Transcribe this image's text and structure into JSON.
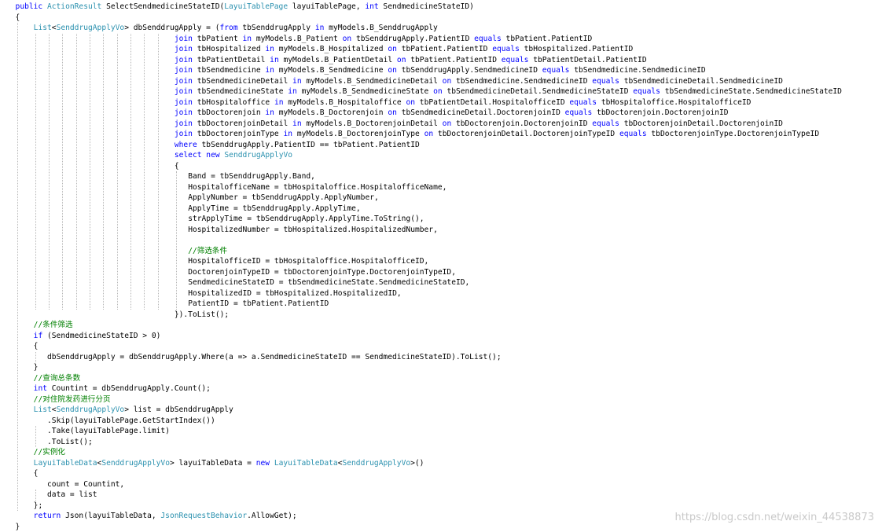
{
  "code": {
    "lines": [
      {
        "indent": 2,
        "tokens": [
          {
            "t": "kw",
            "s": "public "
          },
          {
            "t": "ty",
            "s": "ActionResult"
          },
          {
            "t": "pl",
            "s": " SelectSendmedicineStateID("
          },
          {
            "t": "ty",
            "s": "LayuiTablePage"
          },
          {
            "t": "pl",
            "s": " layuiTablePage, "
          },
          {
            "t": "kw",
            "s": "int"
          },
          {
            "t": "pl",
            "s": " SendmedicineStateID)"
          }
        ]
      },
      {
        "indent": 2,
        "tokens": [
          {
            "t": "pl",
            "s": "{"
          }
        ]
      },
      {
        "indent": 6,
        "tokens": [
          {
            "t": "ty",
            "s": "List"
          },
          {
            "t": "pl",
            "s": "<"
          },
          {
            "t": "ty",
            "s": "SenddrugApplyVo"
          },
          {
            "t": "pl",
            "s": "> dbSenddrugApply = ("
          },
          {
            "t": "kw",
            "s": "from"
          },
          {
            "t": "pl",
            "s": " tbSenddrugApply "
          },
          {
            "t": "kw",
            "s": "in"
          },
          {
            "t": "pl",
            "s": " myModels.B_SenddrugApply"
          }
        ]
      },
      {
        "indent": 37,
        "tokens": [
          {
            "t": "kw",
            "s": "join"
          },
          {
            "t": "pl",
            "s": " tbPatient "
          },
          {
            "t": "kw",
            "s": "in"
          },
          {
            "t": "pl",
            "s": " myModels.B_Patient "
          },
          {
            "t": "kw",
            "s": "on"
          },
          {
            "t": "pl",
            "s": " tbSenddrugApply.PatientID "
          },
          {
            "t": "kw",
            "s": "equals"
          },
          {
            "t": "pl",
            "s": " tbPatient.PatientID"
          }
        ]
      },
      {
        "indent": 37,
        "tokens": [
          {
            "t": "kw",
            "s": "join"
          },
          {
            "t": "pl",
            "s": " tbHospitalized "
          },
          {
            "t": "kw",
            "s": "in"
          },
          {
            "t": "pl",
            "s": " myModels.B_Hospitalized "
          },
          {
            "t": "kw",
            "s": "on"
          },
          {
            "t": "pl",
            "s": " tbPatient.PatientID "
          },
          {
            "t": "kw",
            "s": "equals"
          },
          {
            "t": "pl",
            "s": " tbHospitalized.PatientID"
          }
        ]
      },
      {
        "indent": 37,
        "tokens": [
          {
            "t": "kw",
            "s": "join"
          },
          {
            "t": "pl",
            "s": " tbPatientDetail "
          },
          {
            "t": "kw",
            "s": "in"
          },
          {
            "t": "pl",
            "s": " myModels.B_PatientDetail "
          },
          {
            "t": "kw",
            "s": "on"
          },
          {
            "t": "pl",
            "s": " tbPatient.PatientID "
          },
          {
            "t": "kw",
            "s": "equals"
          },
          {
            "t": "pl",
            "s": " tbPatientDetail.PatientID"
          }
        ]
      },
      {
        "indent": 37,
        "tokens": [
          {
            "t": "kw",
            "s": "join"
          },
          {
            "t": "pl",
            "s": " tbSendmedicine "
          },
          {
            "t": "kw",
            "s": "in"
          },
          {
            "t": "pl",
            "s": " myModels.B_Sendmedicine "
          },
          {
            "t": "kw",
            "s": "on"
          },
          {
            "t": "pl",
            "s": " tbSenddrugApply.SendmedicineID "
          },
          {
            "t": "kw",
            "s": "equals"
          },
          {
            "t": "pl",
            "s": " tbSendmedicine.SendmedicineID"
          }
        ]
      },
      {
        "indent": 37,
        "tokens": [
          {
            "t": "kw",
            "s": "join"
          },
          {
            "t": "pl",
            "s": " tbSendmedicineDetail "
          },
          {
            "t": "kw",
            "s": "in"
          },
          {
            "t": "pl",
            "s": " myModels.B_SendmedicineDetail "
          },
          {
            "t": "kw",
            "s": "on"
          },
          {
            "t": "pl",
            "s": " tbSendmedicine.SendmedicineID "
          },
          {
            "t": "kw",
            "s": "equals"
          },
          {
            "t": "pl",
            "s": " tbSendmedicineDetail.SendmedicineID"
          }
        ]
      },
      {
        "indent": 37,
        "tokens": [
          {
            "t": "kw",
            "s": "join"
          },
          {
            "t": "pl",
            "s": " tbSendmedicineState "
          },
          {
            "t": "kw",
            "s": "in"
          },
          {
            "t": "pl",
            "s": " myModels.B_SendmedicineState "
          },
          {
            "t": "kw",
            "s": "on"
          },
          {
            "t": "pl",
            "s": " tbSendmedicineDetail.SendmedicineStateID "
          },
          {
            "t": "kw",
            "s": "equals"
          },
          {
            "t": "pl",
            "s": " tbSendmedicineState.SendmedicineStateID"
          }
        ]
      },
      {
        "indent": 37,
        "tokens": [
          {
            "t": "kw",
            "s": "join"
          },
          {
            "t": "pl",
            "s": " tbHospitaloffice "
          },
          {
            "t": "kw",
            "s": "in"
          },
          {
            "t": "pl",
            "s": " myModels.B_Hospitaloffice "
          },
          {
            "t": "kw",
            "s": "on"
          },
          {
            "t": "pl",
            "s": " tbPatientDetail.HospitalofficeID "
          },
          {
            "t": "kw",
            "s": "equals"
          },
          {
            "t": "pl",
            "s": " tbHospitaloffice.HospitalofficeID"
          }
        ]
      },
      {
        "indent": 37,
        "tokens": [
          {
            "t": "kw",
            "s": "join"
          },
          {
            "t": "pl",
            "s": " tbDoctorenjoin "
          },
          {
            "t": "kw",
            "s": "in"
          },
          {
            "t": "pl",
            "s": " myModels.B_Doctorenjoin "
          },
          {
            "t": "kw",
            "s": "on"
          },
          {
            "t": "pl",
            "s": " tbSendmedicineDetail.DoctorenjoinID "
          },
          {
            "t": "kw",
            "s": "equals"
          },
          {
            "t": "pl",
            "s": " tbDoctorenjoin.DoctorenjoinID"
          }
        ]
      },
      {
        "indent": 37,
        "tokens": [
          {
            "t": "kw",
            "s": "join"
          },
          {
            "t": "pl",
            "s": " tbDoctorenjoinDetail "
          },
          {
            "t": "kw",
            "s": "in"
          },
          {
            "t": "pl",
            "s": " myModels.B_DoctorenjoinDetail "
          },
          {
            "t": "kw",
            "s": "on"
          },
          {
            "t": "pl",
            "s": " tbDoctorenjoin.DoctorenjoinID "
          },
          {
            "t": "kw",
            "s": "equals"
          },
          {
            "t": "pl",
            "s": " tbDoctorenjoinDetail.DoctorenjoinID"
          }
        ]
      },
      {
        "indent": 37,
        "tokens": [
          {
            "t": "kw",
            "s": "join"
          },
          {
            "t": "pl",
            "s": " tbDoctorenjoinType "
          },
          {
            "t": "kw",
            "s": "in"
          },
          {
            "t": "pl",
            "s": " myModels.B_DoctorenjoinType "
          },
          {
            "t": "kw",
            "s": "on"
          },
          {
            "t": "pl",
            "s": " tbDoctorenjoinDetail.DoctorenjoinTypeID "
          },
          {
            "t": "kw",
            "s": "equals"
          },
          {
            "t": "pl",
            "s": " tbDoctorenjoinType.DoctorenjoinTypeID"
          }
        ]
      },
      {
        "indent": 37,
        "tokens": [
          {
            "t": "kw",
            "s": "where"
          },
          {
            "t": "pl",
            "s": " tbSenddrugApply.PatientID == tbPatient.PatientID"
          }
        ]
      },
      {
        "indent": 37,
        "tokens": [
          {
            "t": "kw",
            "s": "select new "
          },
          {
            "t": "ty",
            "s": "SenddrugApplyVo"
          }
        ]
      },
      {
        "indent": 37,
        "tokens": [
          {
            "t": "pl",
            "s": "{"
          }
        ]
      },
      {
        "indent": 40,
        "tokens": [
          {
            "t": "pl",
            "s": "Band = tbSenddrugApply.Band,"
          }
        ]
      },
      {
        "indent": 40,
        "tokens": [
          {
            "t": "pl",
            "s": "HospitalofficeName = tbHospitaloffice.HospitalofficeName,"
          }
        ]
      },
      {
        "indent": 40,
        "tokens": [
          {
            "t": "pl",
            "s": "ApplyNumber = tbSenddrugApply.ApplyNumber,"
          }
        ]
      },
      {
        "indent": 40,
        "tokens": [
          {
            "t": "pl",
            "s": "ApplyTime = tbSenddrugApply.ApplyTime,"
          }
        ]
      },
      {
        "indent": 40,
        "tokens": [
          {
            "t": "pl",
            "s": "strApplyTime = tbSenddrugApply.ApplyTime.ToString(),"
          }
        ]
      },
      {
        "indent": 40,
        "tokens": [
          {
            "t": "pl",
            "s": "HospitalizedNumber = tbHospitalized.HospitalizedNumber,"
          }
        ]
      },
      {
        "indent": 40,
        "tokens": []
      },
      {
        "indent": 40,
        "tokens": [
          {
            "t": "cm",
            "s": "//筛选条件"
          }
        ]
      },
      {
        "indent": 40,
        "tokens": [
          {
            "t": "pl",
            "s": "HospitalofficeID = tbHospitaloffice.HospitalofficeID,"
          }
        ]
      },
      {
        "indent": 40,
        "tokens": [
          {
            "t": "pl",
            "s": "DoctorenjoinTypeID = tbDoctorenjoinType.DoctorenjoinTypeID,"
          }
        ]
      },
      {
        "indent": 40,
        "tokens": [
          {
            "t": "pl",
            "s": "SendmedicineStateID = tbSendmedicineState.SendmedicineStateID,"
          }
        ]
      },
      {
        "indent": 40,
        "tokens": [
          {
            "t": "pl",
            "s": "HospitalizedID = tbHospitalized.HospitalizedID,"
          }
        ]
      },
      {
        "indent": 40,
        "tokens": [
          {
            "t": "pl",
            "s": "PatientID = tbPatient.PatientID"
          }
        ]
      },
      {
        "indent": 37,
        "tokens": [
          {
            "t": "pl",
            "s": "}).ToList();"
          }
        ]
      },
      {
        "indent": 6,
        "tokens": [
          {
            "t": "cm",
            "s": "//条件筛选"
          }
        ]
      },
      {
        "indent": 6,
        "tokens": [
          {
            "t": "kw",
            "s": "if"
          },
          {
            "t": "pl",
            "s": " (SendmedicineStateID > 0)"
          }
        ]
      },
      {
        "indent": 6,
        "tokens": [
          {
            "t": "pl",
            "s": "{"
          }
        ]
      },
      {
        "indent": 9,
        "tokens": [
          {
            "t": "pl",
            "s": "dbSenddrugApply = dbSenddrugApply.Where(a => a.SendmedicineStateID == SendmedicineStateID).ToList();"
          }
        ]
      },
      {
        "indent": 6,
        "tokens": [
          {
            "t": "pl",
            "s": "}"
          }
        ]
      },
      {
        "indent": 6,
        "tokens": [
          {
            "t": "cm",
            "s": "//查询总条数"
          }
        ]
      },
      {
        "indent": 6,
        "tokens": [
          {
            "t": "kw",
            "s": "int"
          },
          {
            "t": "pl",
            "s": " Countint = dbSenddrugApply.Count();"
          }
        ]
      },
      {
        "indent": 6,
        "tokens": [
          {
            "t": "cm",
            "s": "//对住院发药进行分页"
          }
        ]
      },
      {
        "indent": 6,
        "tokens": [
          {
            "t": "ty",
            "s": "List"
          },
          {
            "t": "pl",
            "s": "<"
          },
          {
            "t": "ty",
            "s": "SenddrugApplyVo"
          },
          {
            "t": "pl",
            "s": "> list = dbSenddrugApply"
          }
        ]
      },
      {
        "indent": 9,
        "tokens": [
          {
            "t": "pl",
            "s": ".Skip(layuiTablePage.GetStartIndex())"
          }
        ]
      },
      {
        "indent": 9,
        "tokens": [
          {
            "t": "pl",
            "s": ".Take(layuiTablePage.limit)"
          }
        ]
      },
      {
        "indent": 9,
        "tokens": [
          {
            "t": "pl",
            "s": ".ToList();"
          }
        ]
      },
      {
        "indent": 6,
        "tokens": [
          {
            "t": "cm",
            "s": "//实例化"
          }
        ]
      },
      {
        "indent": 6,
        "tokens": [
          {
            "t": "ty",
            "s": "LayuiTableData"
          },
          {
            "t": "pl",
            "s": "<"
          },
          {
            "t": "ty",
            "s": "SenddrugApplyVo"
          },
          {
            "t": "pl",
            "s": "> layuiTableData = "
          },
          {
            "t": "kw",
            "s": "new "
          },
          {
            "t": "ty",
            "s": "LayuiTableData"
          },
          {
            "t": "pl",
            "s": "<"
          },
          {
            "t": "ty",
            "s": "SenddrugApplyVo"
          },
          {
            "t": "pl",
            "s": ">()"
          }
        ]
      },
      {
        "indent": 6,
        "tokens": [
          {
            "t": "pl",
            "s": "{"
          }
        ]
      },
      {
        "indent": 9,
        "tokens": [
          {
            "t": "pl",
            "s": "count = Countint,"
          }
        ]
      },
      {
        "indent": 9,
        "tokens": [
          {
            "t": "pl",
            "s": "data = list"
          }
        ]
      },
      {
        "indent": 6,
        "tokens": [
          {
            "t": "pl",
            "s": "};"
          }
        ]
      },
      {
        "indent": 6,
        "tokens": [
          {
            "t": "kw",
            "s": "return "
          },
          {
            "t": "pl",
            "s": "Json(layuiTableData, "
          },
          {
            "t": "ty",
            "s": "JsonRequestBehavior"
          },
          {
            "t": "pl",
            "s": ".AllowGet);"
          }
        ]
      },
      {
        "indent": 2,
        "tokens": [
          {
            "t": "pl",
            "s": "}"
          }
        ]
      }
    ]
  },
  "watermark": "https://blog.csdn.net/weixin_44538873",
  "colors": {
    "keyword": "#0000ff",
    "type": "#2b91af",
    "comment": "#008000",
    "plain": "#000000",
    "guide": "#b8b8b8"
  }
}
